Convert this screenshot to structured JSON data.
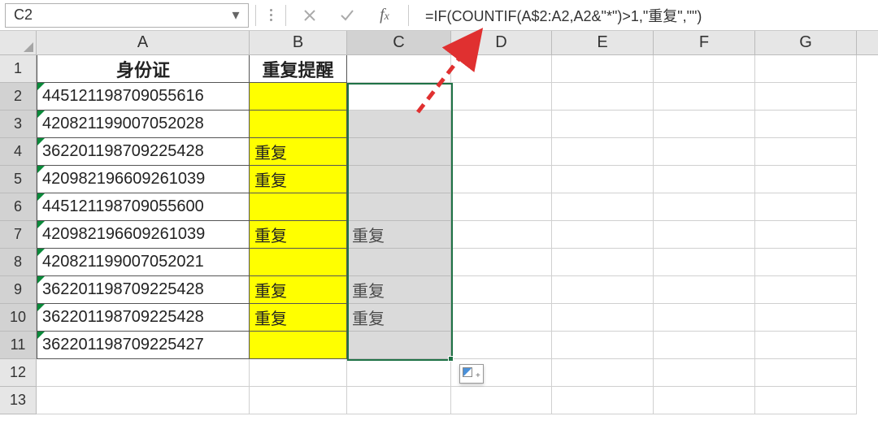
{
  "namebox": {
    "value": "C2"
  },
  "formula_bar": {
    "formula": "=IF(COUNTIF(A$2:A2,A2&\"*\")>1,\"重复\",\"\")"
  },
  "columns": [
    "A",
    "B",
    "C",
    "D",
    "E",
    "F",
    "G"
  ],
  "col_widths": {
    "A": 262,
    "B": 120,
    "C": 128,
    "D": 124,
    "E": 125,
    "F": 125,
    "G": 125
  },
  "selected_col": "C",
  "selected_rows": [
    2,
    3,
    4,
    5,
    6,
    7,
    8,
    9,
    10,
    11
  ],
  "row_count": 13,
  "headers": {
    "A": "身份证",
    "B": "重复提醒"
  },
  "rows": [
    {
      "A": "445121198709055616",
      "B": "",
      "C": ""
    },
    {
      "A": "420821199007052028",
      "B": "",
      "C": ""
    },
    {
      "A": "362201198709225428",
      "B": "重复",
      "C": ""
    },
    {
      "A": "420982196609261039",
      "B": "重复",
      "C": ""
    },
    {
      "A": "445121198709055600",
      "B": "",
      "C": ""
    },
    {
      "A": "420982196609261039",
      "B": "重复",
      "C": "重复"
    },
    {
      "A": "420821199007052021",
      "B": "",
      "C": ""
    },
    {
      "A": "362201198709225428",
      "B": "重复",
      "C": "重复"
    },
    {
      "A": "362201198709225428",
      "B": "重复",
      "C": "重复"
    },
    {
      "A": "362201198709225427",
      "B": "",
      "C": ""
    }
  ],
  "icons": {
    "cancel": "✕",
    "enter": "✓",
    "fx": "fx",
    "dropdown": "▾"
  }
}
